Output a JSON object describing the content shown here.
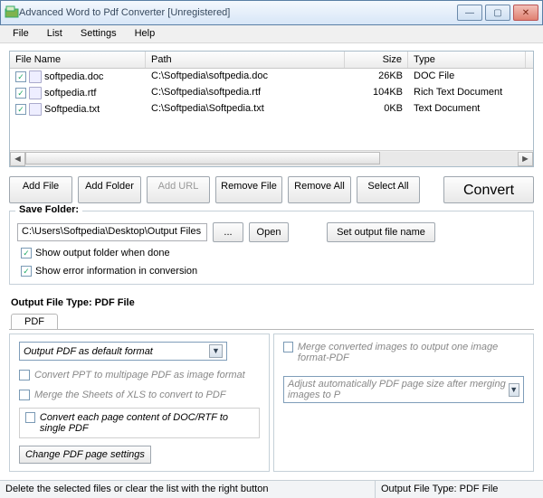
{
  "window": {
    "title": "Advanced Word to Pdf Converter [Unregistered]"
  },
  "menus": [
    "File",
    "List",
    "Settings",
    "Help"
  ],
  "columns": {
    "name": "File Name",
    "path": "Path",
    "size": "Size",
    "type": "Type"
  },
  "files": [
    {
      "name": "softpedia.doc",
      "path": "C:\\Softpedia\\softpedia.doc",
      "size": "26KB",
      "type": "DOC File"
    },
    {
      "name": "softpedia.rtf",
      "path": "C:\\Softpedia\\softpedia.rtf",
      "size": "104KB",
      "type": "Rich Text Document"
    },
    {
      "name": "Softpedia.txt",
      "path": "C:\\Softpedia\\Softpedia.txt",
      "size": "0KB",
      "type": "Text Document"
    }
  ],
  "toolbar": {
    "addfile": "Add File",
    "addfolder": "Add Folder",
    "addurl": "Add URL",
    "removefile": "Remove File",
    "removeall": "Remove All",
    "selectall": "Select All",
    "convert": "Convert"
  },
  "save": {
    "legend": "Save Folder:",
    "path": "C:\\Users\\Softpedia\\Desktop\\Output Files",
    "browse": "...",
    "open": "Open",
    "setname": "Set output file name",
    "showfolder": "Show output folder when done",
    "showerror": "Show error information in conversion"
  },
  "output": {
    "title": "Output File Type:  PDF File",
    "tab": "PDF",
    "combo": "Output PDF as default format",
    "ppt": "Convert PPT to multipage PDF as image format",
    "xls": "Merge the Sheets of XLS to convert to PDF",
    "docrtf": "Convert each page content of DOC/RTF to single PDF",
    "change": "Change PDF page settings",
    "merge": "Merge converted images to output one image format-PDF",
    "adjust": "Adjust automatically PDF page size after merging images to P"
  },
  "status": {
    "left": "Delete the selected files or clear the list with the right button",
    "right": "Output File Type:  PDF File"
  }
}
